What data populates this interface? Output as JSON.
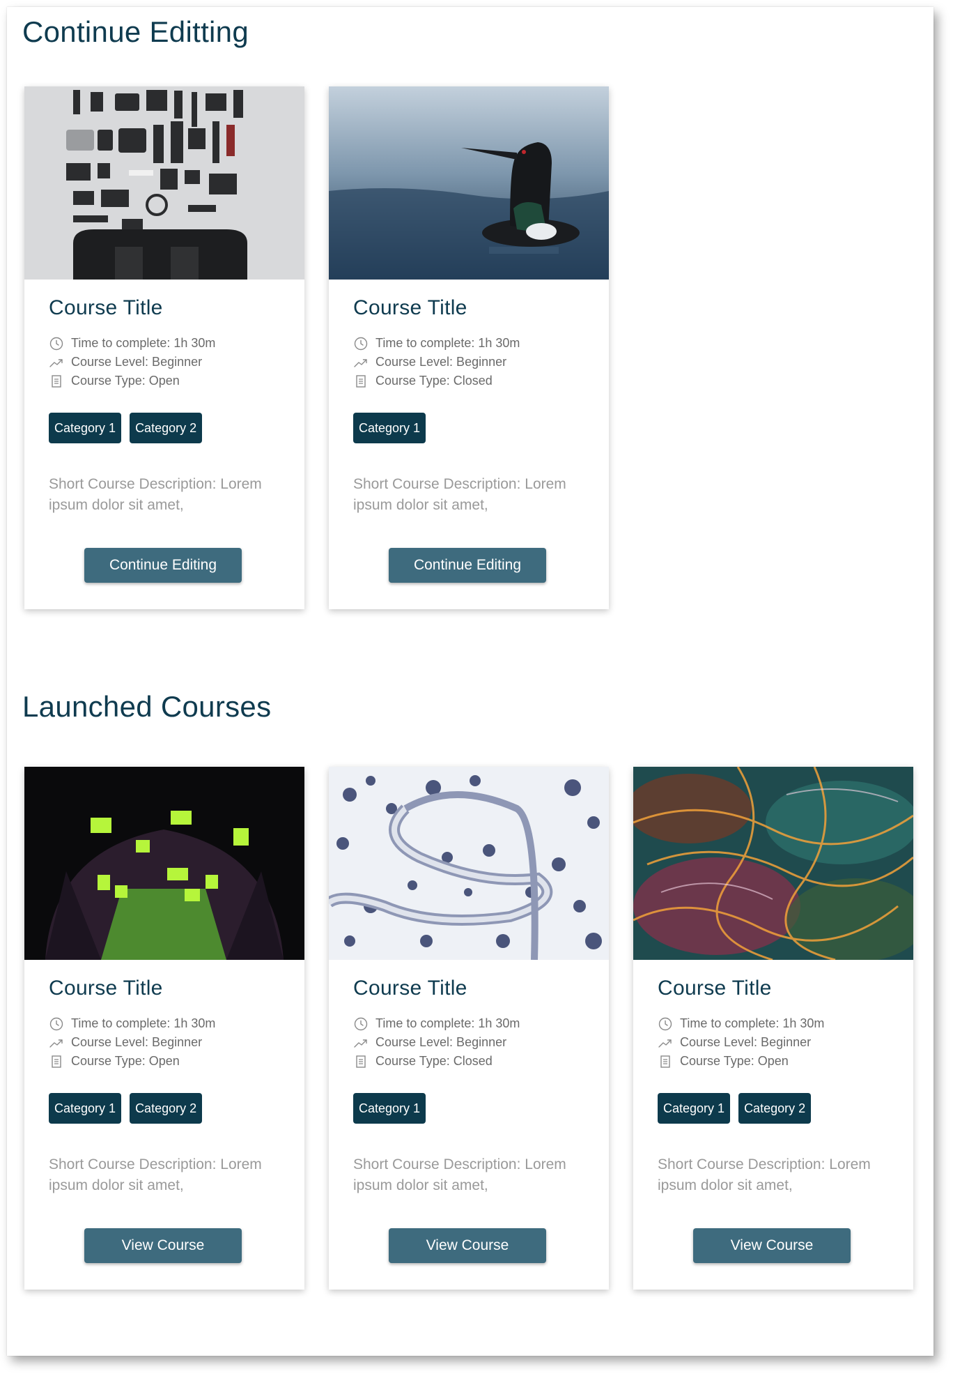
{
  "sections": {
    "editing": {
      "title": "Continue Editting",
      "cards": [
        {
          "image": "camera-gear-flatlay",
          "title": "Course Title",
          "time": "Time to complete: 1h 30m",
          "level": "Course Level: Beginner",
          "type": "Course Type: Open",
          "categories": [
            "Category 1",
            "Category 2"
          ],
          "description": "Short Course Description: Lorem ipsum dolor sit amet,",
          "button": "Continue Editing"
        },
        {
          "image": "loon-on-water",
          "title": "Course Title",
          "time": "Time to complete: 1h 30m",
          "level": "Course Level: Beginner",
          "type": "Course Type: Closed",
          "categories": [
            "Category 1"
          ],
          "description": "Short Course Description: Lorem ipsum dolor sit amet,",
          "button": "Continue Editing"
        }
      ]
    },
    "launched": {
      "title": "Launched Courses",
      "cards": [
        {
          "image": "green-screens-room",
          "title": "Course Title",
          "time": "Time to complete: 1h 30m",
          "level": "Course Level: Beginner",
          "type": "Course Type: Open",
          "categories": [
            "Category 1",
            "Category 2"
          ],
          "description": "Short Course Description: Lorem ipsum dolor sit amet,",
          "button": "View Course"
        },
        {
          "image": "snowy-winding-road",
          "title": "Course Title",
          "time": "Time to complete: 1h 30m",
          "level": "Course Level: Beginner",
          "type": "Course Type: Closed",
          "categories": [
            "Category 1"
          ],
          "description": "Short Course Description: Lorem ipsum dolor sit amet,",
          "button": "View Course"
        },
        {
          "image": "abstract-light-swirls",
          "title": "Course Title",
          "time": "Time to complete: 1h 30m",
          "level": "Course Level: Beginner",
          "type": "Course Type: Open",
          "categories": [
            "Category 1",
            "Category 2"
          ],
          "description": "Short Course Description: Lorem ipsum dolor sit amet,",
          "button": "View Course"
        }
      ]
    }
  },
  "colors": {
    "heading": "#0f3b4f",
    "chip": "#0d3a4c",
    "button": "#3e6b7e",
    "meta_text": "#6a6a6a",
    "description_text": "#9a9a9a"
  },
  "icons": {
    "time": "clock-icon",
    "level": "trend-up-icon",
    "type": "document-icon"
  }
}
